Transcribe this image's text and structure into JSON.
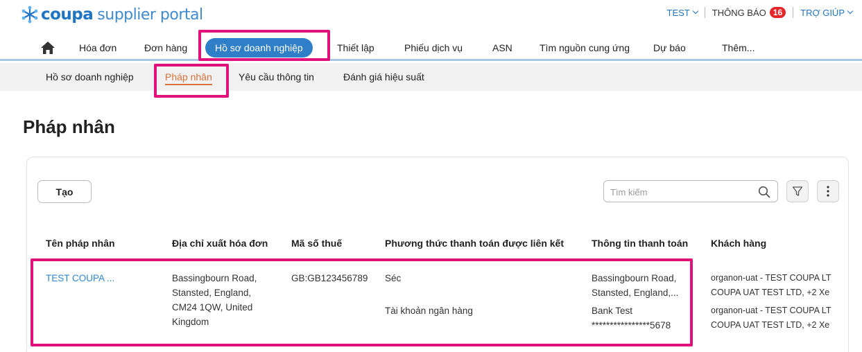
{
  "brand": {
    "coupa": "coupa",
    "rest": "supplier portal",
    "accent": "#1f74c4",
    "icon": "coupa-snowflake-icon"
  },
  "header": {
    "user_menu": "TEST",
    "notifications_label": "THÔNG BÁO",
    "notifications_count": "16",
    "help_label": "TRỢ GIÚP"
  },
  "main_nav": {
    "home_icon": "home-icon",
    "items": [
      {
        "label": "Hóa đơn"
      },
      {
        "label": "Đơn hàng"
      },
      {
        "label": "Hồ sơ doanh nghiệp",
        "active": true
      },
      {
        "label": "Thiết lập"
      },
      {
        "label": "Phiếu dịch vụ"
      },
      {
        "label": "ASN"
      },
      {
        "label": "Tìm nguồn cung ứng"
      },
      {
        "label": "Dự báo"
      },
      {
        "label": "Thêm..."
      }
    ]
  },
  "sub_nav": {
    "items": [
      {
        "label": "Hồ sơ doanh nghiệp"
      },
      {
        "label": "Pháp nhân",
        "active": true
      },
      {
        "label": "Yêu cầu thông tin"
      },
      {
        "label": "Đánh giá hiệu suất"
      }
    ]
  },
  "page": {
    "title": "Pháp nhân"
  },
  "toolbar": {
    "create_label": "Tạo",
    "search_placeholder": "Tìm kiếm"
  },
  "table": {
    "headers": [
      "Tên pháp nhân",
      "Địa chỉ xuất hóa đơn",
      "Mã số thuế",
      "Phương thức thanh toán được liên kết",
      "Thông tin thanh toán",
      "Khách hàng"
    ],
    "rows": [
      {
        "name": "TEST COUPA ...",
        "address": [
          "Bassingbourn Road,",
          "Stansted, England,",
          "CM24 1QW, United",
          "Kingdom"
        ],
        "tax_id": "GB:GB123456789",
        "payment_methods": [
          "Séc",
          "Tài khoản ngân hàng"
        ],
        "payment_info": [
          [
            "Bassingbourn Road,",
            "Stansted, England,..."
          ],
          [
            "Bank Test",
            "****************5678"
          ]
        ],
        "customers": [
          [
            "organon-uat - TEST COUPA LT",
            "COUPA UAT TEST LTD, +2 Xe"
          ],
          [
            "organon-uat - TEST COUPA LT",
            "COUPA UAT TEST LTD, +2 Xe"
          ]
        ]
      }
    ]
  },
  "colors": {
    "highlight": "#e0117a",
    "active_pill": "#2f7fc8",
    "sub_active": "#d9713b",
    "badge": "#e5252a"
  }
}
